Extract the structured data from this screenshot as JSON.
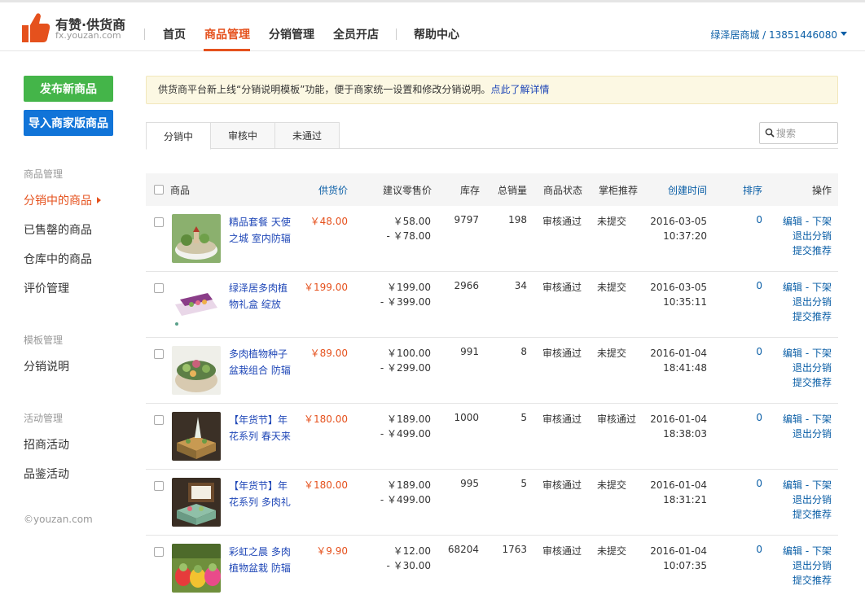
{
  "brand": {
    "title": "有赞·供货商",
    "subtitle": "fx.youzan.com",
    "color": "#e5511d"
  },
  "nav": {
    "items": [
      "首页",
      "商品管理",
      "分销管理",
      "全员开店",
      "帮助中心"
    ],
    "active": "商品管理",
    "user": "绿泽居商城 / 13851446080"
  },
  "sidebar": {
    "publish_button": "发布新商品",
    "import_button": "导入商家版商品",
    "groups": [
      {
        "title": "商品管理",
        "items": [
          "分销中的商品",
          "已售罄的商品",
          "仓库中的商品",
          "评价管理"
        ]
      },
      {
        "title": "模板管理",
        "items": [
          "分销说明"
        ]
      },
      {
        "title": "活动管理",
        "items": [
          "招商活动",
          "品鉴活动"
        ]
      }
    ],
    "active_item": "分销中的商品",
    "copyright": "©youzan.com"
  },
  "notice": {
    "text": "供货商平台新上线“分销说明模板”功能，便于商家统一设置和修改分销说明。",
    "link": "点此了解详情"
  },
  "tabs": [
    "分销中",
    "审核中",
    "未通过"
  ],
  "active_tab": "分销中",
  "search": {
    "placeholder": "搜索"
  },
  "table": {
    "headers": {
      "product": "商品",
      "supply_price": "供货价",
      "retail_price": "建议零售价",
      "stock": "库存",
      "total_sales": "总销量",
      "status": "商品状态",
      "recommend": "掌柜推荐",
      "created": "创建时间",
      "sort": "排序",
      "ops": "操作"
    },
    "rows": [
      {
        "name": "精品套餐 天使之城 室内防辐",
        "supply": "￥48.00",
        "retail_min": "￥58.00",
        "retail_max": "- ￥78.00",
        "stock": "9797",
        "sales": "198",
        "status": "审核通过",
        "recommend": "未提交",
        "date": "2016-03-05",
        "time": "10:37:20",
        "sort": "0",
        "op1": "编辑 - 下架",
        "op2": "退出分销",
        "op3": "提交推荐"
      },
      {
        "name": "绿泽居多肉植物礼盒 绽放",
        "supply": "￥199.00",
        "retail_min": "￥199.00",
        "retail_max": "- ￥399.00",
        "stock": "2966",
        "sales": "34",
        "status": "审核通过",
        "recommend": "未提交",
        "date": "2016-03-05",
        "time": "10:35:11",
        "sort": "0",
        "op1": "编辑 - 下架",
        "op2": "退出分销",
        "op3": "提交推荐"
      },
      {
        "name": "多肉植物种子盆栽组合 防辐",
        "supply": "￥89.00",
        "retail_min": "￥100.00",
        "retail_max": "- ￥299.00",
        "stock": "991",
        "sales": "8",
        "status": "审核通过",
        "recommend": "未提交",
        "date": "2016-01-04",
        "time": "18:41:48",
        "sort": "0",
        "op1": "编辑 - 下架",
        "op2": "退出分销",
        "op3": "提交推荐"
      },
      {
        "name": "【年货节】年花系列 春天来",
        "supply": "￥180.00",
        "retail_min": "￥189.00",
        "retail_max": "- ￥499.00",
        "stock": "1000",
        "sales": "5",
        "status": "审核通过",
        "recommend": "审核通过",
        "date": "2016-01-04",
        "time": "18:38:03",
        "sort": "0",
        "op1": "编辑 - 下架",
        "op2": "退出分销",
        "op3": ""
      },
      {
        "name": "【年货节】年花系列 多肉礼",
        "supply": "￥180.00",
        "retail_min": "￥189.00",
        "retail_max": "- ￥499.00",
        "stock": "995",
        "sales": "5",
        "status": "审核通过",
        "recommend": "未提交",
        "date": "2016-01-04",
        "time": "18:31:21",
        "sort": "0",
        "op1": "编辑 - 下架",
        "op2": "退出分销",
        "op3": "提交推荐"
      },
      {
        "name": "彩虹之晨 多肉植物盆栽 防辐",
        "supply": "￥9.90",
        "retail_min": "￥12.00",
        "retail_max": "- ￥30.00",
        "stock": "68204",
        "sales": "1763",
        "status": "审核通过",
        "recommend": "未提交",
        "date": "2016-01-04",
        "time": "10:07:35",
        "sort": "0",
        "op1": "编辑 - 下架",
        "op2": "退出分销",
        "op3": "提交推荐"
      }
    ]
  }
}
